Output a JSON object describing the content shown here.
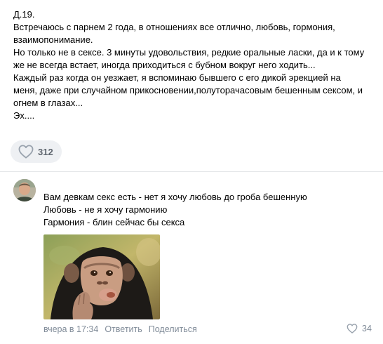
{
  "post": {
    "lines": [
      "Д.19.",
      "Встречаюсь с парнем 2 года, в отношениях все отлично, любовь, гормония,",
      "взаимопонимание.",
      "Но только не в сексе. 3 минуты удовольствия, редкие оральные ласки, да и к тому",
      "же не всегда встает, иногда приходиться с бубном вокруг него ходить...",
      "Каждый раз когда он уезжает, я вспоминаю бывшего с его дикой эрекцией на",
      "меня, даже при случайном прикосновении,полуторачасовым бешенным сексом, и",
      "огнем в глазах...",
      "Эх...."
    ],
    "like_count": "312",
    "like_icon": "heart-outline-icon"
  },
  "comment": {
    "avatar": "user-avatar",
    "lines": [
      "Вам девкам секс есть - нет я хочу любовь до гроба бешенную",
      "Любовь - не я хочу гармонию",
      "Гармония - блин сейчас бы секса"
    ],
    "image": "chimpanzee-photo",
    "time": "вчера в 17:34",
    "reply_label": "Ответить",
    "share_label": "Поделиться",
    "like_count": "34"
  },
  "colors": {
    "like_pill_bg": "#eef0f3",
    "meta_text": "#818c99",
    "divider": "#e3e5e8"
  }
}
